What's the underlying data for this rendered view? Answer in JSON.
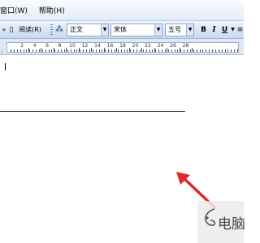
{
  "menu": {
    "items": [
      {
        "label": "窗口(W)",
        "key": "window"
      },
      {
        "label": "帮助(H)",
        "key": "help"
      }
    ]
  },
  "toolbar": {
    "read_label": "阅读(R)",
    "style_value": "正文",
    "font_value": "宋体",
    "size_value": "五号",
    "bold_label": "B",
    "italic_label": "I",
    "underline_label": "U"
  },
  "ruler": {
    "numbers": [
      "2",
      "4",
      "6",
      "8",
      "10",
      "12",
      "14",
      "16",
      "18",
      "20",
      "22",
      "24",
      "26",
      "28"
    ]
  },
  "watermark": {
    "text": "电脑"
  },
  "colors": {
    "menubar": "#e3ecf8",
    "toolbar": "#c9d9f1",
    "arrow": "#e0292b"
  }
}
